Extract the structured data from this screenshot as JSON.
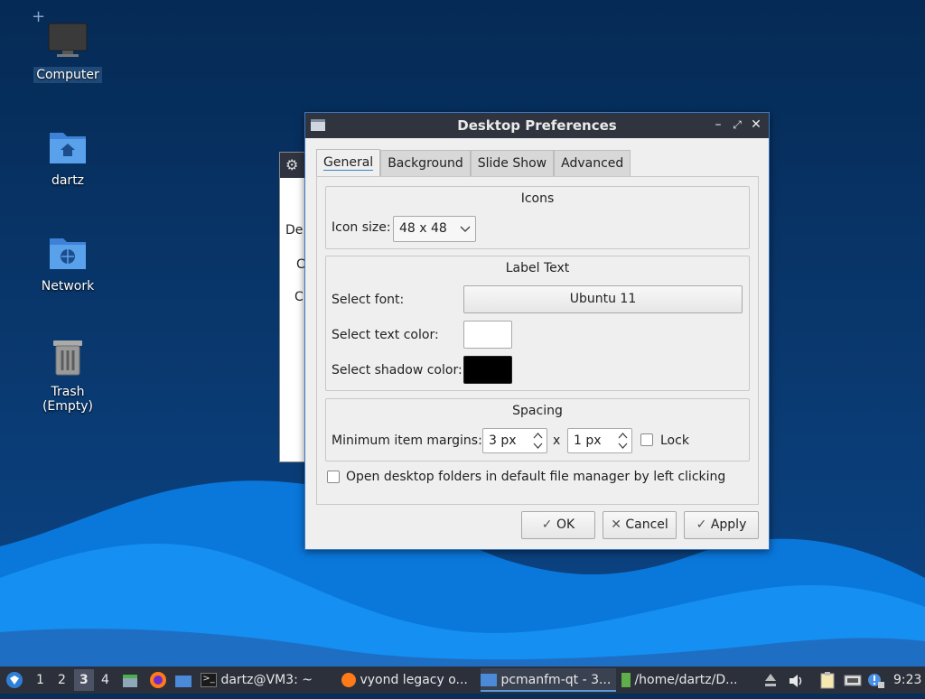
{
  "desktop": {
    "icons": [
      {
        "label": "Computer",
        "icon": "computer-icon"
      },
      {
        "label": "dartz",
        "icon": "home-folder-icon"
      },
      {
        "label": "Network",
        "icon": "network-folder-icon"
      },
      {
        "label": "Trash (Empty)",
        "icon": "trash-icon"
      }
    ]
  },
  "background_window": {
    "labels": [
      "De",
      "C",
      "C"
    ]
  },
  "dialog": {
    "title": "Desktop Preferences",
    "tabs": [
      "General",
      "Background",
      "Slide Show",
      "Advanced"
    ],
    "icons_group": {
      "title": "Icons",
      "icon_size_label": "Icon size:",
      "icon_size_value": "48 x 48"
    },
    "label_text_group": {
      "title": "Label Text",
      "font_label": "Select font:",
      "font_value": "Ubuntu 11",
      "text_color_label": "Select text color:",
      "text_color": "#ffffff",
      "shadow_color_label": "Select shadow color:",
      "shadow_color": "#000000"
    },
    "spacing_group": {
      "title": "Spacing",
      "margins_label": "Minimum item margins:",
      "margin_x": "3 px",
      "separator": "x",
      "margin_y": "1 px",
      "lock_label": "Lock",
      "lock_checked": false
    },
    "open_folders_label": "Open desktop folders in default file manager by left clicking",
    "open_folders_checked": false,
    "buttons": {
      "ok": "OK",
      "cancel": "Cancel",
      "apply": "Apply"
    }
  },
  "taskbar": {
    "workspaces": [
      "1",
      "2",
      "3",
      "4"
    ],
    "active_workspace": "3",
    "tasks": [
      {
        "label": "dartz@VM3: ~",
        "icon": "terminal-icon"
      },
      {
        "label": "vyond legacy o...",
        "icon": "firefox-icon"
      },
      {
        "label": "pcmanfm-qt - 3...",
        "icon": "folder-icon"
      },
      {
        "label": "/home/dartz/D...",
        "icon": "file-manager-icon"
      }
    ],
    "clock": "9:23"
  },
  "colors": {
    "accent": "#3a84c8",
    "titlebar": "#2f343f",
    "taskbar": "#2b303b"
  }
}
